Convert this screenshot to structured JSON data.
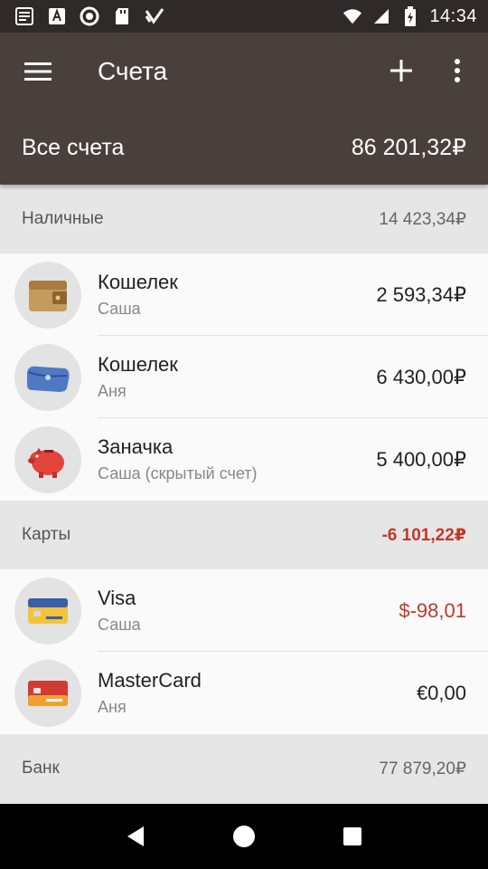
{
  "status_bar": {
    "time": "14:34"
  },
  "app_bar": {
    "title": "Счета"
  },
  "total": {
    "label": "Все счета",
    "value": "86 201,32₽"
  },
  "groups": [
    {
      "name": "Наличные",
      "total": "14 423,34₽",
      "accounts": [
        {
          "name": "Кошелек",
          "owner": "Саша",
          "balance": "2 593,34₽",
          "icon": "brown-wallet-icon"
        },
        {
          "name": "Кошелек",
          "owner": "Аня",
          "balance": "6 430,00₽",
          "icon": "blue-purse-icon"
        },
        {
          "name": "Заначка",
          "owner": "Саша (скрытый счет)",
          "balance": "5 400,00₽",
          "icon": "piggy-bank-icon"
        }
      ]
    },
    {
      "name": "Карты",
      "total": "-6 101,22₽",
      "accounts": [
        {
          "name": "Visa",
          "owner": "Саша",
          "balance": "$-98,01",
          "icon": "visa-card-icon"
        },
        {
          "name": "MasterCard",
          "owner": "Аня",
          "balance": "€0,00",
          "icon": "mastercard-icon"
        }
      ]
    },
    {
      "name": "Банк",
      "total": "77 879,20₽",
      "accounts": []
    }
  ],
  "colors": {
    "app_bar": "#4a403b",
    "status_bar": "#2f2a27",
    "negative": "#c0392b"
  }
}
